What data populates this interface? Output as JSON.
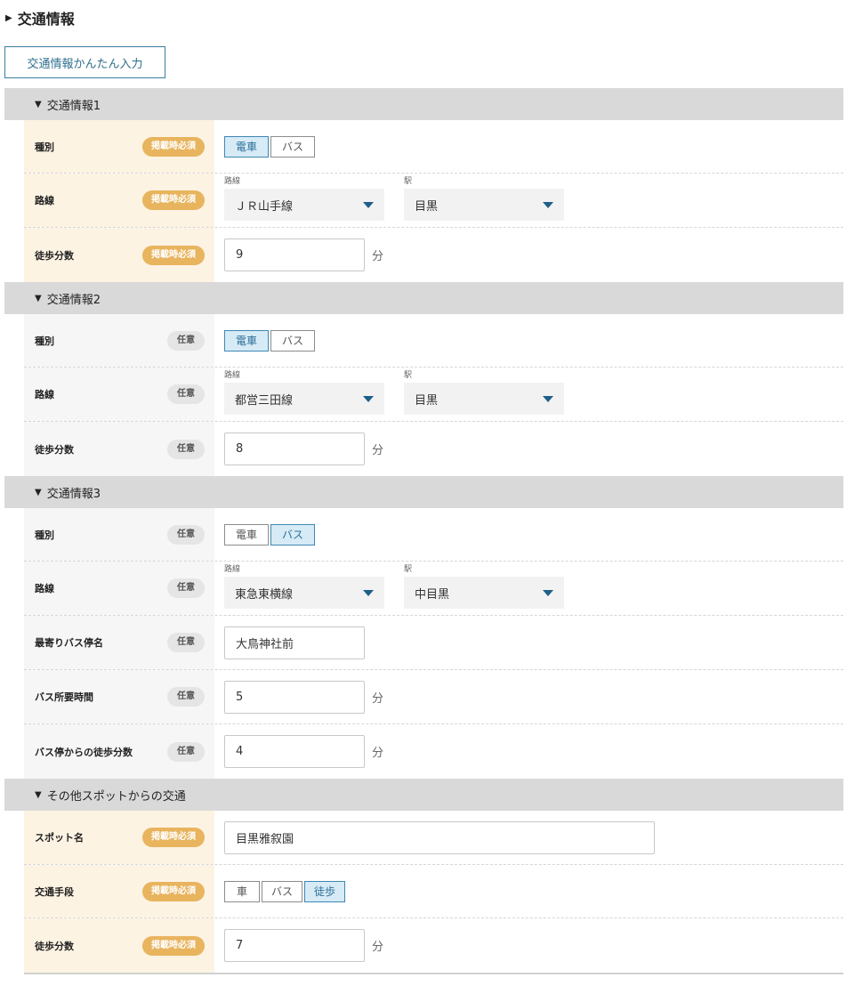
{
  "page": {
    "title": "交通情報",
    "quick_button": "交通情報かんたん入力"
  },
  "badges": {
    "required": "掲載時必須",
    "optional": "任意"
  },
  "sections": [
    {
      "title": "交通情報1",
      "rows": [
        {
          "type": "toggle",
          "label": "種別",
          "req": true,
          "options": [
            "電車",
            "バス"
          ],
          "selected": "電車"
        },
        {
          "type": "selects",
          "label": "路線",
          "req": true,
          "line_label": "路線",
          "line": "ＪＲ山手線",
          "station_label": "駅",
          "station": "目黒"
        },
        {
          "type": "input",
          "label": "徒歩分数",
          "req": true,
          "value": "9",
          "unit": "分"
        }
      ]
    },
    {
      "title": "交通情報2",
      "rows": [
        {
          "type": "toggle",
          "label": "種別",
          "req": false,
          "options": [
            "電車",
            "バス"
          ],
          "selected": "電車"
        },
        {
          "type": "selects",
          "label": "路線",
          "req": false,
          "line_label": "路線",
          "line": "都営三田線",
          "station_label": "駅",
          "station": "目黒"
        },
        {
          "type": "input",
          "label": "徒歩分数",
          "req": false,
          "value": "8",
          "unit": "分"
        }
      ]
    },
    {
      "title": "交通情報3",
      "rows": [
        {
          "type": "toggle",
          "label": "種別",
          "req": false,
          "options": [
            "電車",
            "バス"
          ],
          "selected": "バス"
        },
        {
          "type": "selects",
          "label": "路線",
          "req": false,
          "line_label": "路線",
          "line": "東急東横線",
          "station_label": "駅",
          "station": "中目黒"
        },
        {
          "type": "input",
          "label": "最寄りバス停名",
          "req": false,
          "value": "大鳥神社前",
          "unit": ""
        },
        {
          "type": "input",
          "label": "バス所要時間",
          "req": false,
          "value": "5",
          "unit": "分"
        },
        {
          "type": "input",
          "label": "バス停からの徒歩分数",
          "req": false,
          "value": "4",
          "unit": "分"
        }
      ]
    },
    {
      "title": "その他スポットからの交通",
      "rows": [
        {
          "type": "input",
          "label": "スポット名",
          "req": true,
          "value": "目黒雅叙園",
          "unit": "",
          "wide": true
        },
        {
          "type": "toggle",
          "label": "交通手段",
          "req": true,
          "options": [
            "車",
            "バス",
            "徒歩"
          ],
          "selected": "徒歩"
        },
        {
          "type": "input",
          "label": "徒歩分数",
          "req": true,
          "value": "7",
          "unit": "分"
        }
      ]
    }
  ]
}
